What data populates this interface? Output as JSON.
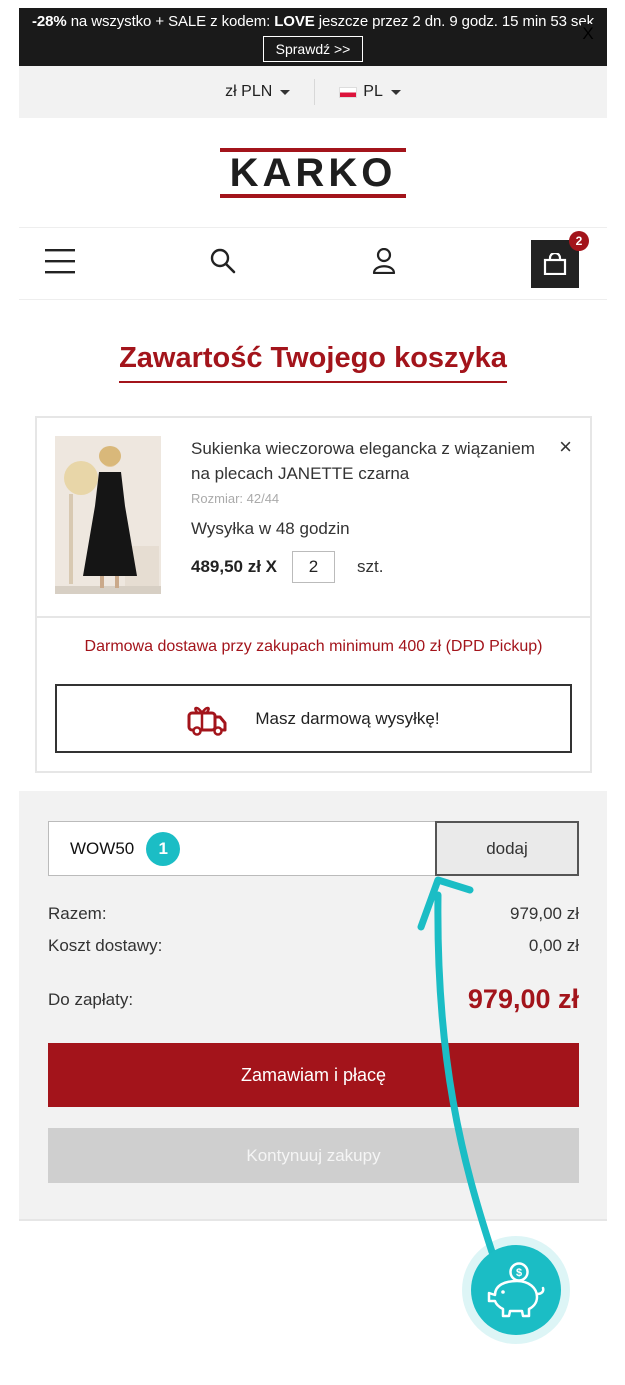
{
  "promo": {
    "discount": "-28%",
    "text_mid": " na wszystko + SALE z kodem: ",
    "code": "LOVE",
    "text_end": " jeszcze przez 2 dn. 9 godz. 15 min 53 sek",
    "button": "Sprawdź >>",
    "close": "X"
  },
  "locale": {
    "currency": "zł PLN",
    "language": "PL"
  },
  "logo": {
    "text": "KARKO"
  },
  "nav": {
    "cart_count": "2"
  },
  "page_title": "Zawartość Twojego koszyka",
  "product": {
    "name": "Sukienka wieczorowa elegancka z wiązaniem na plecach JANETTE czarna",
    "size": "Rozmiar: 42/44",
    "shipping": "Wysyłka w 48 godzin",
    "price": "489,50 zł X",
    "quantity": "2",
    "unit": "szt.",
    "remove": "×"
  },
  "free_shipping": {
    "note": "Darmowa dostawa przy zakupach minimum 400 zł (DPD Pickup)",
    "button": "Masz darmową wysyłkę!"
  },
  "summary": {
    "coupon_value": "WOW50",
    "coupon_step": "1",
    "coupon_button": "dodaj",
    "subtotal_label": "Razem:",
    "subtotal_value": "979,00 zł",
    "shipping_label": "Koszt dostawy:",
    "shipping_value": "0,00 zł",
    "total_label": "Do zapłaty:",
    "total_value": "979,00 zł",
    "order_button": "Zamawiam i płacę",
    "continue_button": "Kontynuuj zakupy"
  },
  "colors": {
    "brand": "#a3141b",
    "accent": "#1bbdc5",
    "dark": "#1a1a1a"
  }
}
